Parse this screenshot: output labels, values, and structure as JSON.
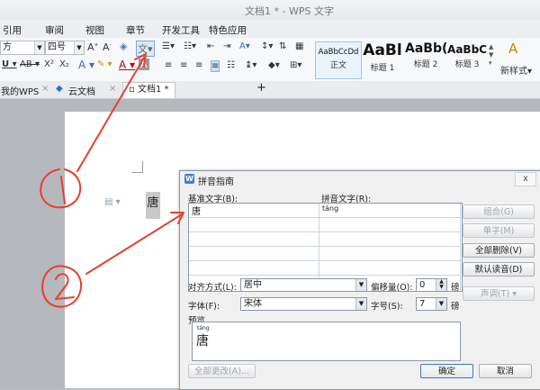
{
  "window": {
    "title": "文档1 * - WPS 文字"
  },
  "ribbon": {
    "tabs": [
      "引用",
      "审阅",
      "视图",
      "章节",
      "开发工具",
      "特色应用"
    ],
    "font_name": "方",
    "font_size": "四号",
    "styles": [
      {
        "sample": "AaBbCcDd",
        "name": "正文"
      },
      {
        "sample": "AaBl",
        "name": "标题 1"
      },
      {
        "sample": "AaBb(",
        "name": "标题 2"
      },
      {
        "sample": "AaBbC",
        "name": "标题 3"
      }
    ],
    "new_style_label": "新样式"
  },
  "doctabs": {
    "items": [
      "我的WPS",
      "云文档",
      "文档1 *"
    ],
    "add_label": "+"
  },
  "document": {
    "selected_char": "唐"
  },
  "dialog": {
    "title": "拼音指南",
    "base_text_label": "基准文字(B):",
    "ruby_text_label": "拼音文字(R):",
    "base_rows": [
      "唐",
      "",
      "",
      "",
      "",
      ""
    ],
    "ruby_rows": [
      "táng",
      "",
      "",
      "",
      "",
      ""
    ],
    "group_label": "组合(G)",
    "single_label": "单字(M)",
    "clear_all_label": "全部删除(V)",
    "default_label": "默认读音(D)",
    "tone_label": "声调(T)",
    "alignment_label": "对齐方式(L):",
    "alignment_value": "居中",
    "offset_label": "偏移量(O):",
    "offset_value": "0",
    "offset_unit": "磅",
    "font_label": "字体(F):",
    "font_value": "宋体",
    "size_label": "字号(S):",
    "size_value": "7",
    "size_unit": "磅",
    "preview_label": "预览",
    "preview_ruby": "táng",
    "preview_char": "唐",
    "change_all_label": "全部更改(A)...",
    "ok_label": "确定",
    "cancel_label": "取消",
    "close_label": "x"
  },
  "annotations": {
    "marker_1": "1",
    "marker_2": "2",
    "color": "#e8402a"
  }
}
